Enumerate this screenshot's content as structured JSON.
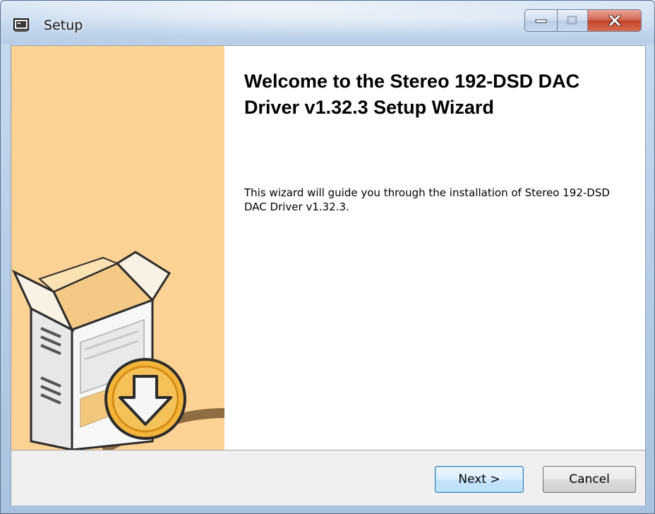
{
  "window": {
    "title": "Setup",
    "icon": "setup-app-icon"
  },
  "caption_buttons": {
    "minimize_icon": "minimize-icon",
    "maximize_icon": "maximize-icon",
    "close_icon": "close-icon"
  },
  "welcome": {
    "heading": "Welcome to the Stereo 192-DSD DAC Driver v1.32.3 Setup Wizard",
    "body": "This wizard will guide you through the installation of Stereo 192-DSD DAC Driver v1.32.3."
  },
  "side_panel": {
    "image": "installer-box-download-icon",
    "background_color": "#fcd295"
  },
  "buttons": {
    "next": "Next >",
    "cancel": "Cancel"
  }
}
